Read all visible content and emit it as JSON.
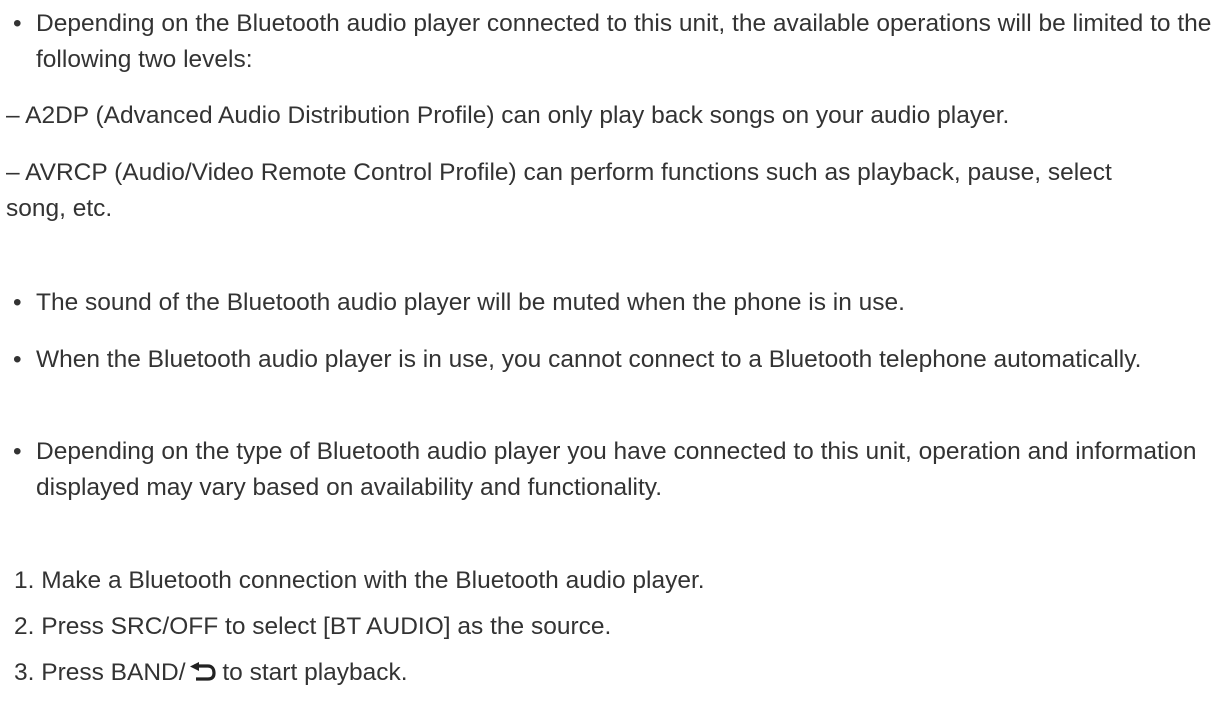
{
  "bullets_top": [
    {
      "marker": "•",
      "text": "Depending on the Bluetooth audio player connected to this unit, the available operations will be limited to the following two levels:"
    }
  ],
  "dashes": [
    {
      "marker": "–",
      "text": "A2DP (Advanced Audio Distribution Profile) can only play back songs on your audio player."
    },
    {
      "marker": "–",
      "text": "AVRCP (Audio/Video Remote Control Profile) can perform functions such as playback, pause, select song, etc."
    }
  ],
  "bullets_bottom": [
    {
      "marker": "•",
      "text": "The sound of the Bluetooth audio player will be muted when the phone is in use."
    },
    {
      "marker": "•",
      "text": "When the Bluetooth audio player is in use, you cannot connect to a Bluetooth telephone automatically."
    },
    {
      "marker": "•",
      "text": "Depending on the type of Bluetooth audio player you have connected to this unit, operation and information displayed may vary based on availability and functionality."
    }
  ],
  "steps": [
    {
      "number": "1.",
      "text": "Make a Bluetooth connection with the Bluetooth audio player."
    },
    {
      "number": "2.",
      "text": "Press SRC/OFF to select [BT AUDIO] as the source."
    },
    {
      "number": "3.",
      "text_before_icon": "Press BAND/",
      "icon": "return-arrow-icon",
      "text_after_icon": " to start playback."
    }
  ]
}
